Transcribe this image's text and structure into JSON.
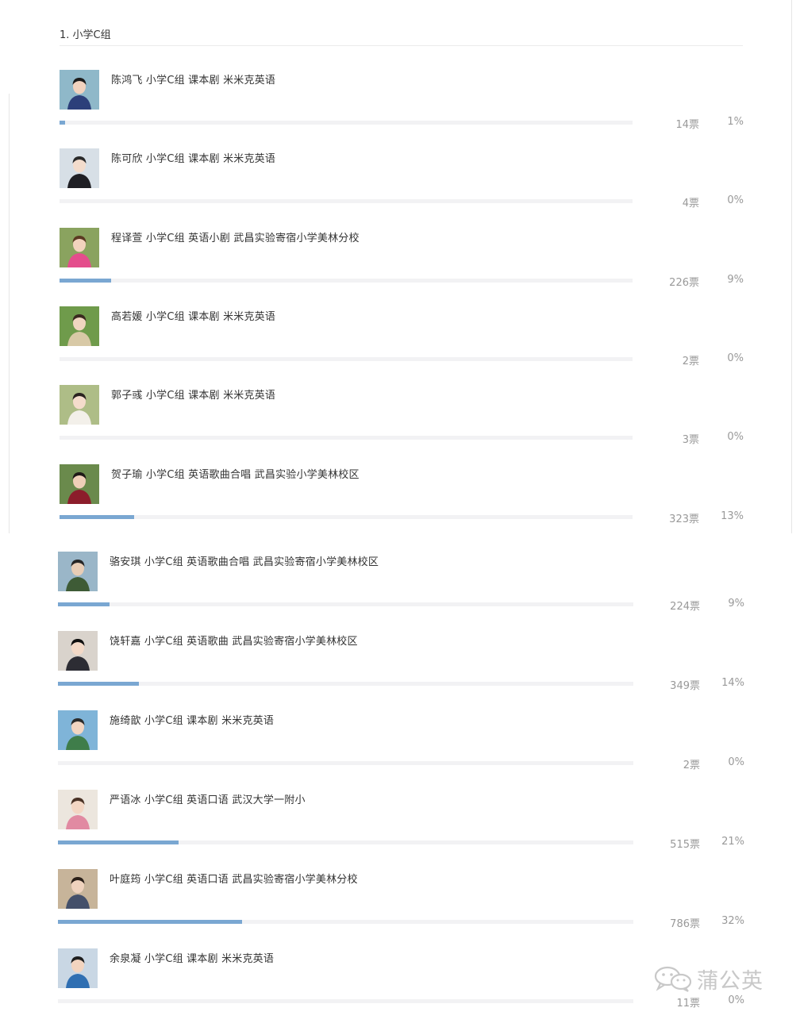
{
  "section": {
    "title": "1. 小学C组"
  },
  "items": [
    {
      "text": "陈鸿飞 小学C组 课本剧 米米克英语",
      "votes": "14票",
      "percent": "1%",
      "share": 0.01,
      "avatar": "child-photo-blue"
    },
    {
      "text": "陈可欣 小学C组 课本剧 米米克英语",
      "votes": "4票",
      "percent": "0%",
      "share": 0.0,
      "avatar": "child-photo-hat"
    },
    {
      "text": "程译萱 小学C组 英语小剧 武昌实验寄宿小学美林分校",
      "votes": "226票",
      "percent": "9%",
      "share": 0.09,
      "avatar": "child-photo-pink-cap"
    },
    {
      "text": "高若媛 小学C组 课本剧 米米克英语",
      "votes": "2票",
      "percent": "0%",
      "share": 0.0,
      "avatar": "child-photo-garden"
    },
    {
      "text": "郭子彧 小学C组 课本剧 米米克英语",
      "votes": "3票",
      "percent": "0%",
      "share": 0.0,
      "avatar": "child-photo-flowers"
    },
    {
      "text": "贺子瑜 小学C组 英语歌曲合唱 武昌实验小学美林校区",
      "votes": "323票",
      "percent": "13%",
      "share": 0.13,
      "avatar": "child-photo-red"
    },
    {
      "text": "骆安琪 小学C组 英语歌曲合唱 武昌实验寄宿小学美林校区",
      "votes": "224票",
      "percent": "9%",
      "share": 0.09,
      "avatar": "child-photo-landscape"
    },
    {
      "text": "饶轩嘉 小学C组 英语歌曲 武昌实验寄宿小学美林校区",
      "votes": "349票",
      "percent": "14%",
      "share": 0.14,
      "avatar": "child-photo-portrait"
    },
    {
      "text": "施绮歆 小学C组 课本剧 米米克英语",
      "votes": "2票",
      "percent": "0%",
      "share": 0.0,
      "avatar": "child-photo-park"
    },
    {
      "text": "严语冰 小学C组 英语口语 武汉大学一附小",
      "votes": "515票",
      "percent": "21%",
      "share": 0.21,
      "avatar": "child-photo-pink-dress"
    },
    {
      "text": "叶庭筠 小学C组 英语口语 武昌实验寄宿小学美林分校",
      "votes": "786票",
      "percent": "32%",
      "share": 0.32,
      "avatar": "child-photo-indoor"
    },
    {
      "text": "余泉凝 小学C组 课本剧 米米克英语",
      "votes": "11票",
      "percent": "0%",
      "share": 0.0,
      "avatar": "child-photo-blue-shirt"
    }
  ],
  "watermark": {
    "text": "蒲公英",
    "icon": "wechat-icon"
  },
  "colors": {
    "bar_fill": "#7aa7d2",
    "bar_track": "#f2f2f4",
    "muted_text": "#999999"
  }
}
